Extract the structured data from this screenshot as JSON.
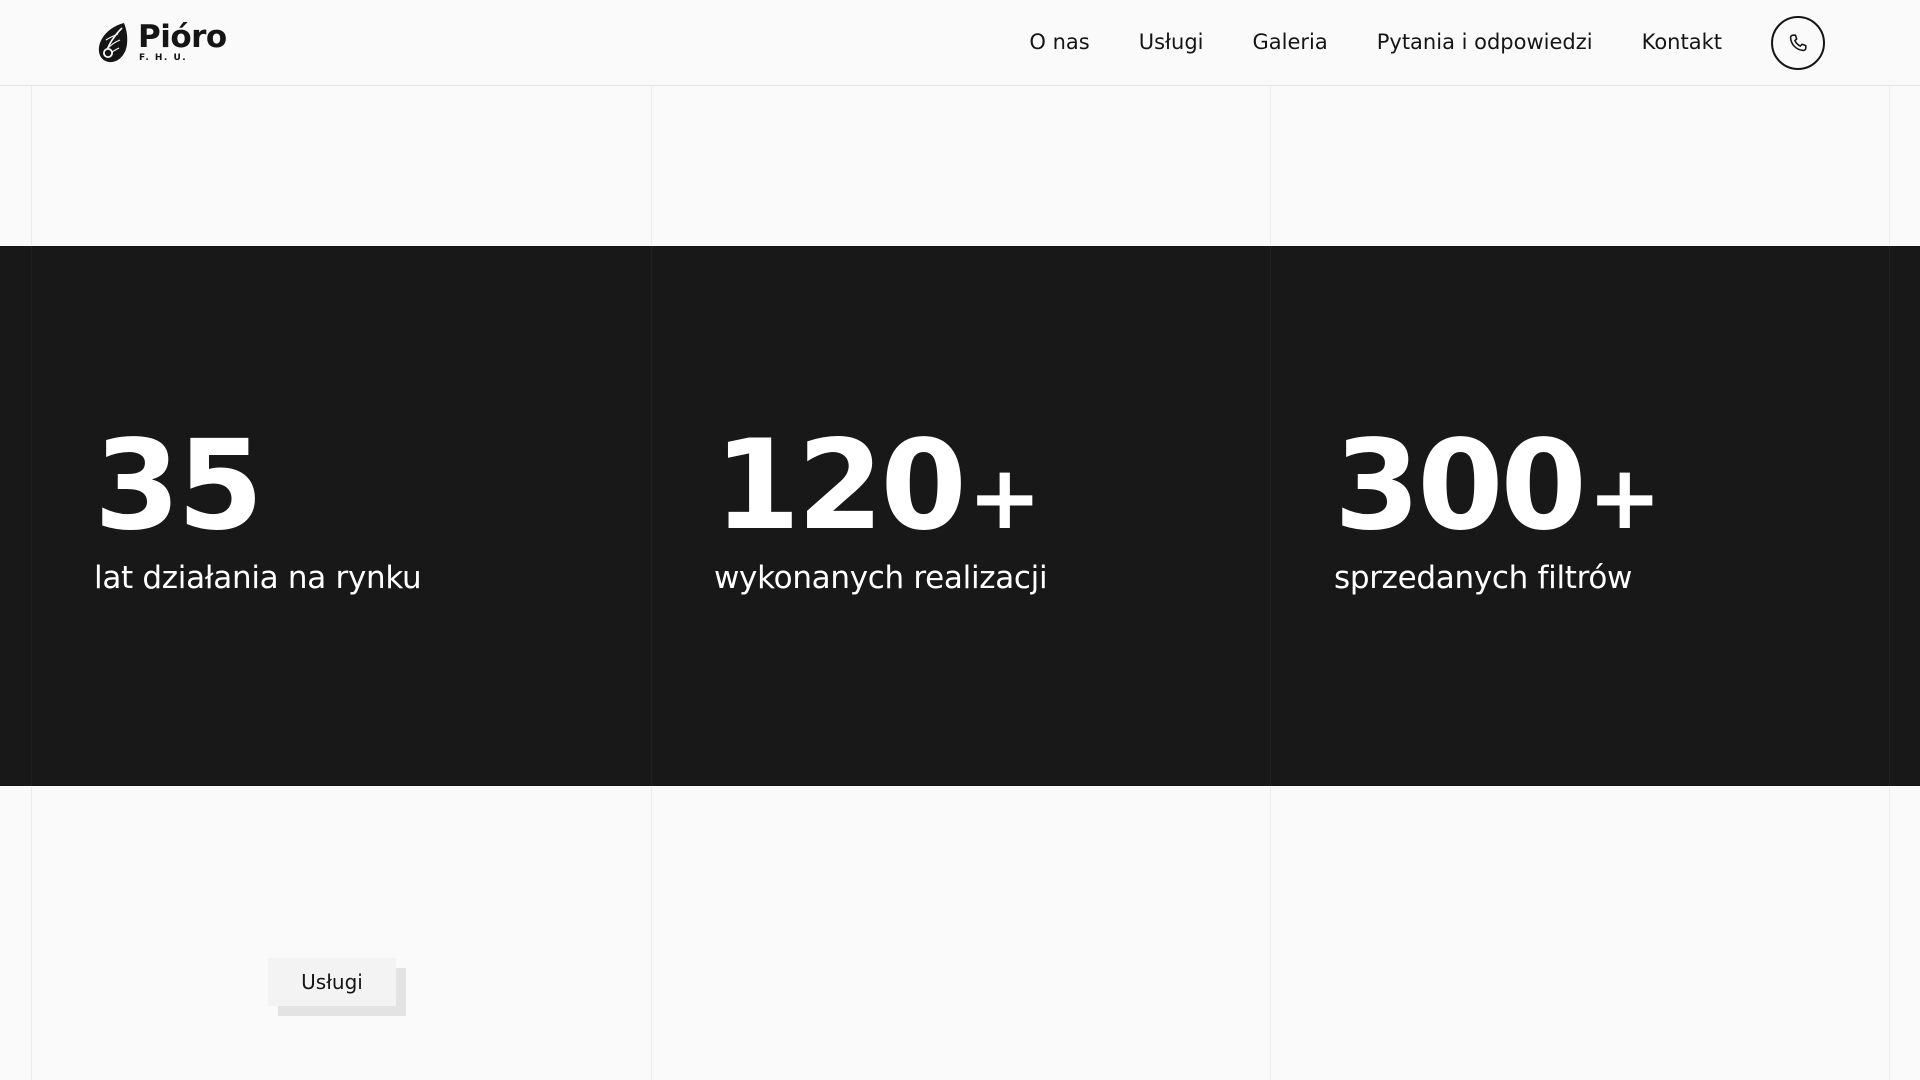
{
  "brand": {
    "name": "Pióro",
    "subtitle": "F. H. U."
  },
  "nav": {
    "items": [
      {
        "label": "O nas"
      },
      {
        "label": "Usługi"
      },
      {
        "label": "Galeria"
      },
      {
        "label": "Pytania i odpowiedzi"
      },
      {
        "label": "Kontakt"
      }
    ],
    "phone_icon": "phone-icon"
  },
  "stats": [
    {
      "number": "35",
      "plus": "",
      "label": "lat działania na rynku"
    },
    {
      "number": "120",
      "plus": "+",
      "label": "wykonanych realizacji"
    },
    {
      "number": "300",
      "plus": "+",
      "label": "sprzedanych filtrów"
    }
  ],
  "services_tag": {
    "label": "Usługi"
  },
  "colors": {
    "background": "#fafafa",
    "dark_band": "#181818",
    "text": "#151515",
    "text_on_dark": "#ffffff"
  }
}
